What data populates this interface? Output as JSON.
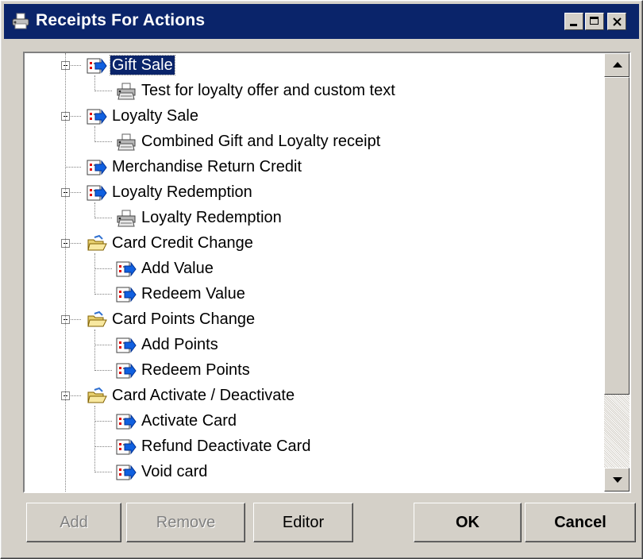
{
  "window": {
    "title": "Receipts For Actions",
    "icon": "receipt-printer-icon"
  },
  "tree": {
    "nodes": [
      {
        "label": "Gift Sale",
        "level": 0,
        "expander": "minus",
        "icon": "action-icon",
        "selected": true
      },
      {
        "label": "Test for loyalty offer and custom text",
        "level": 1,
        "expander": "none",
        "icon": "printer-icon",
        "selected": false
      },
      {
        "label": "Loyalty Sale",
        "level": 0,
        "expander": "minus",
        "icon": "action-icon",
        "selected": false
      },
      {
        "label": "Combined Gift and Loyalty receipt",
        "level": 1,
        "expander": "none",
        "icon": "printer-icon",
        "selected": false
      },
      {
        "label": "Merchandise Return Credit",
        "level": 0,
        "expander": "none",
        "icon": "action-icon",
        "selected": false
      },
      {
        "label": "Loyalty Redemption",
        "level": 0,
        "expander": "minus",
        "icon": "action-icon",
        "selected": false
      },
      {
        "label": "Loyalty Redemption",
        "level": 1,
        "expander": "none",
        "icon": "printer-icon",
        "selected": false
      },
      {
        "label": "Card Credit Change",
        "level": 0,
        "expander": "minus",
        "icon": "folder-open-icon",
        "selected": false
      },
      {
        "label": "Add Value",
        "level": 1,
        "expander": "none",
        "icon": "action-icon",
        "selected": false
      },
      {
        "label": "Redeem Value",
        "level": 1,
        "expander": "none",
        "icon": "action-icon",
        "selected": false
      },
      {
        "label": "Card Points Change",
        "level": 0,
        "expander": "minus",
        "icon": "folder-open-icon",
        "selected": false
      },
      {
        "label": "Add Points",
        "level": 1,
        "expander": "none",
        "icon": "action-icon",
        "selected": false
      },
      {
        "label": "Redeem Points",
        "level": 1,
        "expander": "none",
        "icon": "action-icon",
        "selected": false
      },
      {
        "label": "Card Activate / Deactivate",
        "level": 0,
        "expander": "minus",
        "icon": "folder-open-icon",
        "selected": false
      },
      {
        "label": "Activate Card",
        "level": 1,
        "expander": "none",
        "icon": "action-icon",
        "selected": false
      },
      {
        "label": "Refund Deactivate Card",
        "level": 1,
        "expander": "none",
        "icon": "action-icon",
        "selected": false
      },
      {
        "label": "Void card",
        "level": 1,
        "expander": "none",
        "icon": "action-icon",
        "selected": false
      }
    ]
  },
  "buttons": {
    "add": "Add",
    "remove": "Remove",
    "editor": "Editor",
    "ok": "OK",
    "cancel": "Cancel"
  },
  "colors": {
    "titlebar": "#0a246a",
    "selection": "#0a246a",
    "face": "#d4d0c8"
  }
}
